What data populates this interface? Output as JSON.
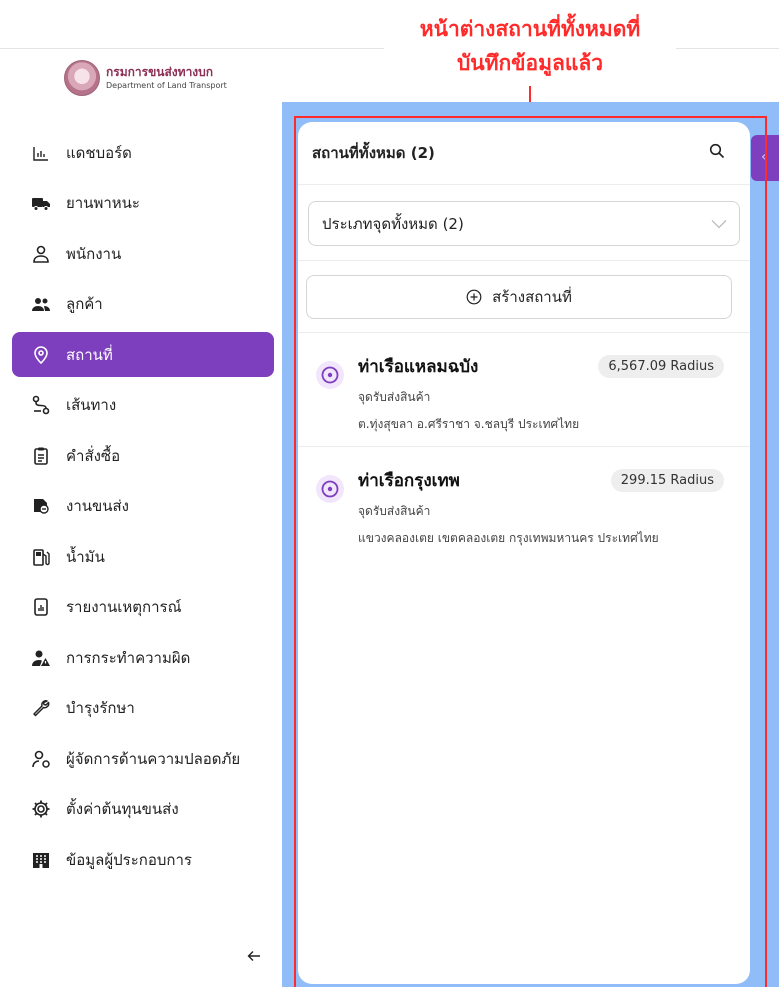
{
  "annotation": {
    "line1": "หน้าต่างสถานที่ทั้งหมดที่",
    "line2": "บันทึกข้อมูลแล้ว"
  },
  "logo": {
    "name_th": "กรมการขนส่งทางบก",
    "name_en": "Department of Land Transport"
  },
  "sidebar": {
    "items": [
      {
        "label": "แดชบอร์ด",
        "icon": "bar-chart-icon"
      },
      {
        "label": "ยานพาหนะ",
        "icon": "truck-icon"
      },
      {
        "label": "พนักงาน",
        "icon": "person-icon"
      },
      {
        "label": "ลูกค้า",
        "icon": "people-icon"
      },
      {
        "label": "สถานที่",
        "icon": "location-pin-icon",
        "active": true
      },
      {
        "label": "เส้นทาง",
        "icon": "route-icon"
      },
      {
        "label": "คำสั่งซื้อ",
        "icon": "clipboard-icon"
      },
      {
        "label": "งานขนส่ง",
        "icon": "delivery-icon"
      },
      {
        "label": "น้ำมัน",
        "icon": "fuel-pump-icon"
      },
      {
        "label": "รายงานเหตุการณ์",
        "icon": "report-icon"
      },
      {
        "label": "การกระทำความผิด",
        "icon": "person-warning-icon"
      },
      {
        "label": "บำรุงรักษา",
        "icon": "wrench-icon"
      },
      {
        "label": "ผู้จัดการด้านความปลอดภัย",
        "icon": "safety-manager-icon"
      },
      {
        "label": "ตั้งค่าต้นทุนขนส่ง",
        "icon": "gear-icon"
      },
      {
        "label": "ข้อมูลผู้ประกอบการ",
        "icon": "building-icon"
      }
    ],
    "collapse_icon": "arrow-left-icon"
  },
  "panel": {
    "title": "สถานที่ทั้งหมด (2)",
    "filter_value": "ประเภทจุดทั้งหมด (2)",
    "create_label": "สร้างสถานที่",
    "locations": [
      {
        "name": "ท่าเรือแหลมฉบัง",
        "radius": "6,567.09 Radius",
        "type": "จุดรับส่งสินค้า",
        "address": "ต.ทุ่งสุขลา อ.ศรีราชา จ.ชลบุรี ประเทศไทย"
      },
      {
        "name": "ท่าเรือกรุงเทพ",
        "radius": "299.15 Radius",
        "type": "จุดรับส่งสินค้า",
        "address": "แขวงคลองเตย เขตคลองเตย กรุงเทพมหานคร ประเทศไทย"
      }
    ]
  },
  "colors": {
    "accent": "#7d3fbe",
    "annotation": "#ff2a2a",
    "backdrop": "#90bcf7"
  }
}
